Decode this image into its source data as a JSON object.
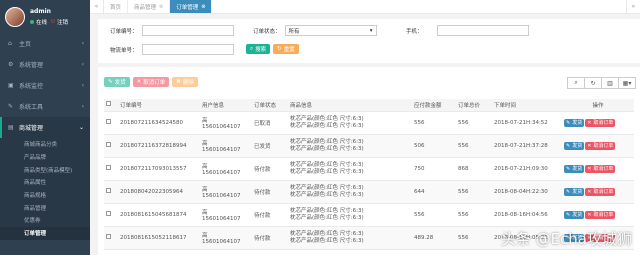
{
  "user": {
    "name": "admin",
    "status": "在线",
    "logout": "注销"
  },
  "nav": [
    {
      "label": "主页",
      "icon": "home-icon",
      "glyph": "⌂"
    },
    {
      "label": "系统管理",
      "icon": "gear-icon",
      "glyph": "⚙"
    },
    {
      "label": "系统监控",
      "icon": "monitor-icon",
      "glyph": "▣"
    },
    {
      "label": "系统工具",
      "icon": "tools-icon",
      "glyph": "✎"
    },
    {
      "label": "商城管理",
      "icon": "shop-icon",
      "glyph": "▤"
    }
  ],
  "subnav": [
    "商城商品分类",
    "产品品牌",
    "商品类型(商品模型)",
    "商品属性",
    "商品规格",
    "商品管理",
    "优惠券",
    "订单管理"
  ],
  "tabs": [
    "首页",
    "商品管理",
    "订单管理"
  ],
  "search": {
    "order_no_label": "订单编号：",
    "status_label": "订单状态：",
    "status_value": "所有",
    "phone_label": "手机：",
    "logistics_label": "物流单号：",
    "search_btn": "搜索",
    "reset_btn": "重置"
  },
  "toolbar": {
    "ship": "发货",
    "cancel": "取消订单",
    "delete": "删除"
  },
  "table": {
    "headers": [
      "订单编号",
      "用户信息",
      "订单状态",
      "商品信息",
      "应付款金额",
      "订单总价",
      "下单时间",
      "操作"
    ],
    "rows": [
      {
        "id": "20180721163452458​0",
        "user_name": "高",
        "user_phone": "15601064107",
        "status": "已取消",
        "goods": [
          "枕芯产品(颜色:红色 尺寸:6:3)",
          "枕芯产品(颜色:红色 尺寸:6:3)"
        ],
        "pay": "556",
        "total": "556",
        "time": "2018-07-21H:34:52"
      },
      {
        "id": "201807211637281899​4",
        "user_name": "高",
        "user_phone": "15601064107",
        "status": "已发货",
        "goods": [
          "枕芯产品(颜色:红色 尺寸:6:3)",
          "枕芯产品(颜色:红色 尺寸:6:3)"
        ],
        "pay": "506",
        "total": "556",
        "time": "2018-07-21H:37:28"
      },
      {
        "id": "20180721170930135​57",
        "user_name": "高",
        "user_phone": "15601064107",
        "status": "待付款",
        "goods": [
          "枕芯产品(颜色:红色 尺寸:6:3)",
          "枕芯产品(颜色:红色 尺寸:6:3)"
        ],
        "pay": "750",
        "total": "868",
        "time": "2018-07-21H:09:30"
      },
      {
        "id": "20180804202230596​4",
        "user_name": "高",
        "user_phone": "15601064107",
        "status": "待付款",
        "goods": [
          "枕芯产品(颜色:红色 尺寸:6:3)",
          "枕芯产品(颜色:红色 尺寸:6:3)"
        ],
        "pay": "644",
        "total": "556",
        "time": "2018-08-04H:22:30"
      },
      {
        "id": "20180816150456818​74",
        "user_name": "高",
        "user_phone": "15601064107",
        "status": "待付款",
        "goods": [
          "枕芯产品(颜色:红色 尺寸:6:3)",
          "枕芯产品(颜色:红色 尺寸:6:3)"
        ],
        "pay": "556",
        "total": "556",
        "time": "2018-08-16H:04:56"
      },
      {
        "id": "201808161505211861​7",
        "user_name": "高",
        "user_phone": "15601064107",
        "status": "待付款",
        "goods": [
          "枕芯产品(颜色:红色 尺寸:6:3)",
          "枕芯产品(颜色:红色 尺寸:6:3)"
        ],
        "pay": "489.28",
        "total": "556",
        "time": "2018-08-16H:05:21"
      }
    ],
    "ship_btn": "发货",
    "cancel_btn": "取消订单"
  },
  "watermark": "头条 @Echa攻城狮",
  "colors": {
    "sidebar": "#2f4050",
    "accent": "#1ab394",
    "tab_active": "#3c8dbc",
    "danger": "#ed5565",
    "warning": "#f8ac59"
  }
}
